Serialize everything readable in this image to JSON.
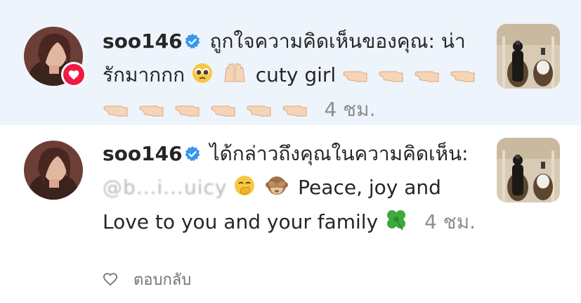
{
  "notifications": [
    {
      "username": "soo146",
      "message": "ถูกใจความคิดเห็นของคุณ: น่ารักมากกก",
      "comment_tail": "cuty girl",
      "time": "4 ชม."
    },
    {
      "username": "soo146",
      "message": "ได้กล่าวถึงคุณในความคิดเห็น:",
      "mention_hidden": "@b...i...uicy",
      "comment_tail": "Peace, joy and Love to you and your family",
      "time": "4 ชม.",
      "reply_label": "ตอบกลับ"
    }
  ],
  "colors": {
    "highlight_bg": "#eef4fb",
    "like_badge": "#ed1c42",
    "verified": "#3897f0",
    "secondary_text": "#8e8e8e"
  }
}
